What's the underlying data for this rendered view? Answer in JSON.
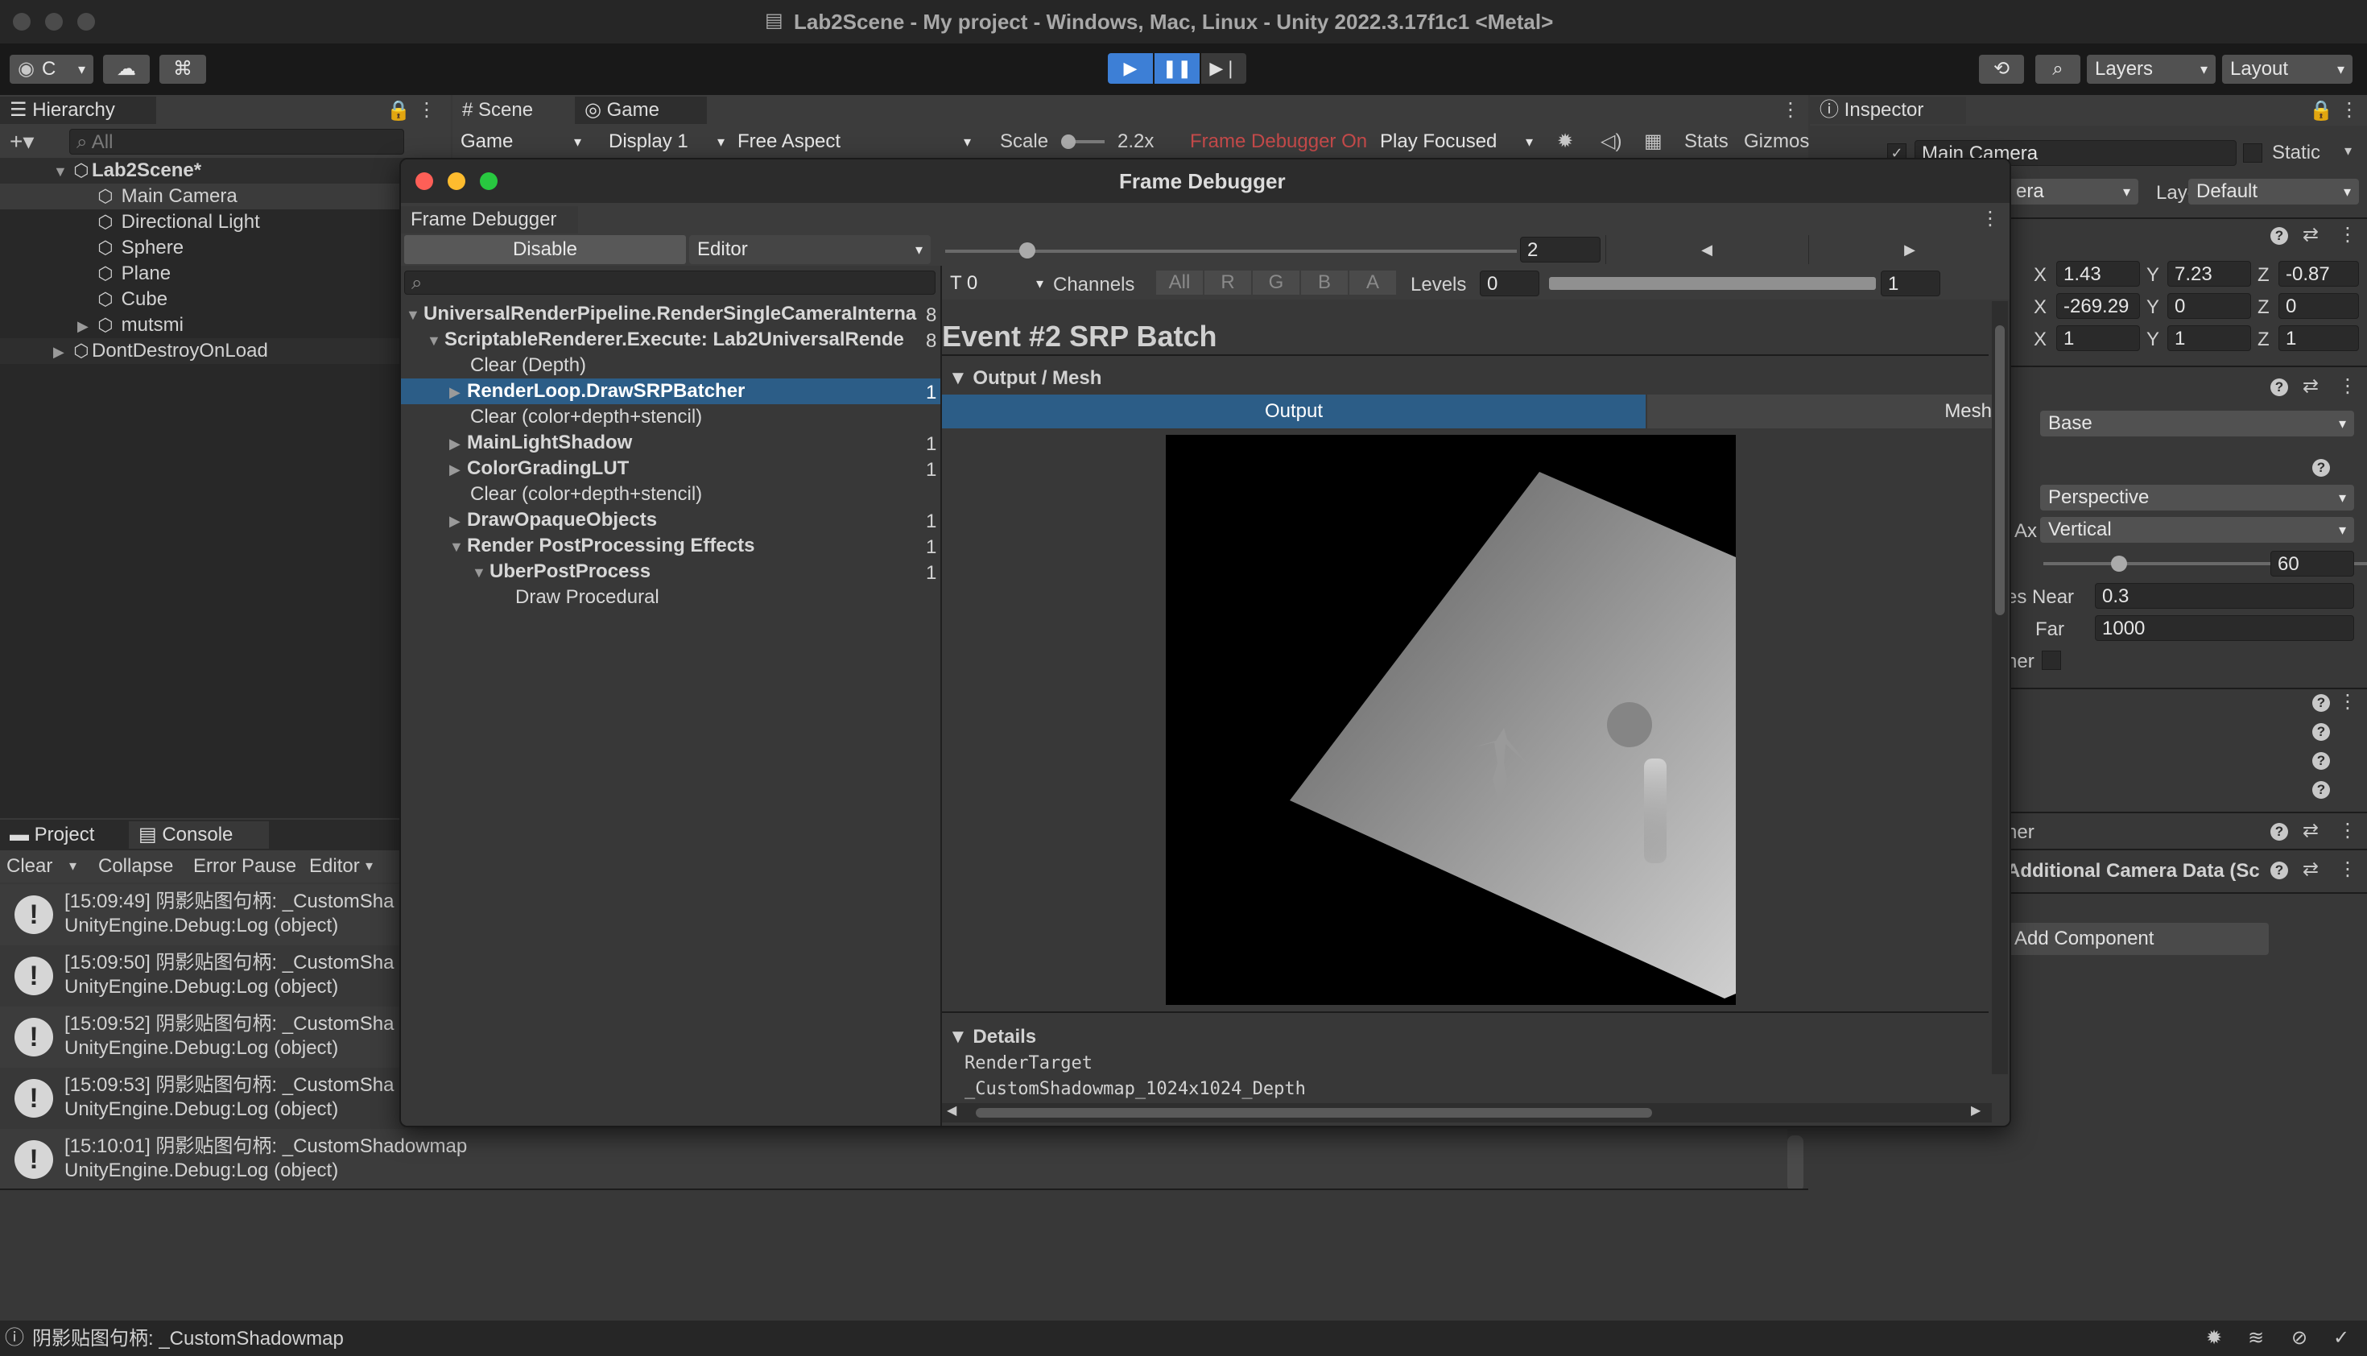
{
  "window": {
    "title": "Lab2Scene - My project - Windows, Mac, Linux - Unity 2022.3.17f1c1 <Metal>"
  },
  "toolbar": {
    "account": "C",
    "layers": "Layers",
    "layout": "Layout"
  },
  "hierarchy": {
    "tab": "Hierarchy",
    "search_placeholder": "All",
    "scene": "Lab2Scene*",
    "items": [
      "Main Camera",
      "Directional Light",
      "Sphere",
      "Plane",
      "Cube",
      "mutsmi"
    ],
    "ddol": "DontDestroyOnLoad"
  },
  "game_view": {
    "tabs": [
      "Scene",
      "Game"
    ],
    "display_mode": "Game",
    "display": "Display 1",
    "aspect": "Free Aspect",
    "scale_label": "Scale",
    "scale_value": "2.2x",
    "frame_debugger_on": "Frame Debugger On",
    "play_mode": "Play Focused",
    "stats": "Stats",
    "gizmos": "Gizmos"
  },
  "inspector": {
    "tab": "Inspector",
    "object_name": "Main Camera",
    "static_label": "Static",
    "tag_partial": "era",
    "layer_label": "Layer",
    "layer_value": "Default",
    "position": {
      "x": "1.43",
      "y": "7.23",
      "z": "-0.87"
    },
    "rotation": {
      "x": "-269.29",
      "y": "0",
      "z": "0"
    },
    "scale": {
      "x": "1",
      "y": "1",
      "z": "1"
    },
    "render_type": "Base",
    "projection": "Perspective",
    "fov_axis_label": "Ax",
    "fov_axis": "Vertical",
    "fov_value": "60",
    "near_label": "es Near",
    "near_value": "0.3",
    "far_label": "Far",
    "far_value": "1000",
    "partial_label_1": "ner",
    "partial_label_2": "ner",
    "additional_data": "Additional Camera Data (Sc",
    "add_component": "Add Component"
  },
  "console": {
    "tabs": [
      "Project",
      "Console"
    ],
    "buttons": {
      "clear": "Clear",
      "collapse": "Collapse",
      "error_pause": "Error Pause",
      "editor": "Editor"
    },
    "entries": [
      {
        "line1": "[15:09:49] 阴影贴图句柄: _CustomSha",
        "line2": "UnityEngine.Debug:Log (object)"
      },
      {
        "line1": "[15:09:50] 阴影贴图句柄: _CustomSha",
        "line2": "UnityEngine.Debug:Log (object)"
      },
      {
        "line1": "[15:09:52] 阴影贴图句柄: _CustomSha",
        "line2": "UnityEngine.Debug:Log (object)"
      },
      {
        "line1": "[15:09:53] 阴影贴图句柄: _CustomSha",
        "line2": "UnityEngine.Debug:Log (object)"
      },
      {
        "line1": "[15:10:01] 阴影贴图句柄: _CustomShadowmap",
        "line2": "UnityEngine.Debug:Log (object)"
      }
    ]
  },
  "status_bar": {
    "message": "阴影贴图句柄: _CustomShadowmap"
  },
  "frame_debugger": {
    "title": "Frame Debugger",
    "tab": "Frame Debugger",
    "disable_button": "Disable",
    "target": "Editor",
    "event_index": "2",
    "rt_label": "T 0",
    "channels_label": "Channels",
    "channels": [
      "All",
      "R",
      "G",
      "B",
      "A"
    ],
    "levels_label": "Levels",
    "levels_min": "0",
    "levels_max": "1",
    "event_title": "Event #2 SRP Batch",
    "section_output": "Output / Mesh",
    "output_tab": "Output",
    "mesh_tab": "Mesh",
    "details_label": "Details",
    "detail_key": "RenderTarget",
    "detail_value": "_CustomShadowmap_1024x1024_Depth",
    "events": [
      {
        "label": "UniversalRenderPipeline.RenderSingleCameraInterna",
        "count": "8"
      },
      {
        "label": "ScriptableRenderer.Execute: Lab2UniversalRende",
        "count": "8"
      },
      {
        "label": "Clear (Depth)",
        "count": ""
      },
      {
        "label": "RenderLoop.DrawSRPBatcher",
        "count": "1"
      },
      {
        "label": "Clear (color+depth+stencil)",
        "count": ""
      },
      {
        "label": "MainLightShadow",
        "count": "1"
      },
      {
        "label": "ColorGradingLUT",
        "count": "1"
      },
      {
        "label": "Clear (color+depth+stencil)",
        "count": ""
      },
      {
        "label": "DrawOpaqueObjects",
        "count": "1"
      },
      {
        "label": "Render PostProcessing Effects",
        "count": "1"
      },
      {
        "label": "UberPostProcess",
        "count": "1"
      },
      {
        "label": "Draw Procedural",
        "count": ""
      }
    ]
  }
}
